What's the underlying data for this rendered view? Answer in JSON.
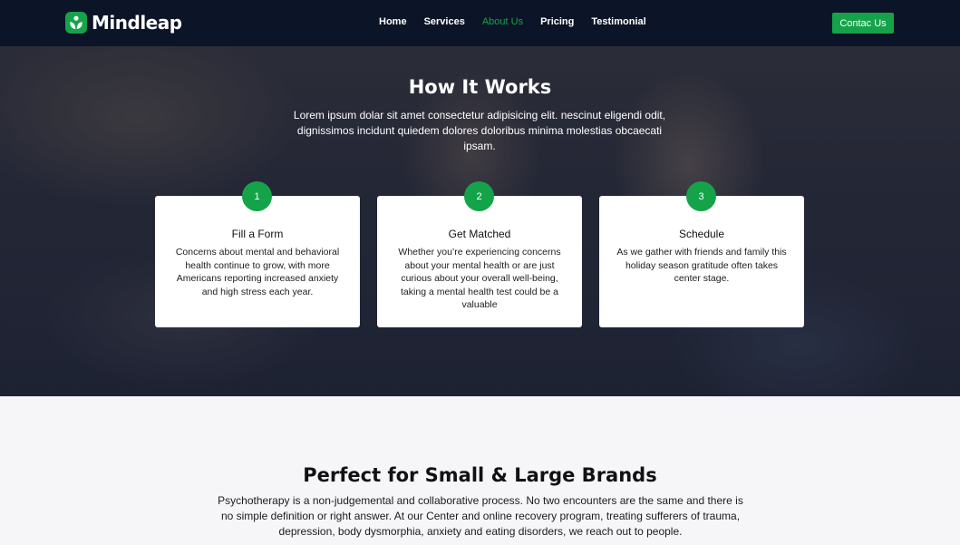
{
  "brand": {
    "name": "Mindleap",
    "accent": "#15a34a",
    "nav_bg": "#0c1527"
  },
  "nav": {
    "items": [
      {
        "label": "Home",
        "active": false
      },
      {
        "label": "Services",
        "active": false
      },
      {
        "label": "About Us",
        "active": true
      },
      {
        "label": "Pricing",
        "active": false
      },
      {
        "label": "Testimonial",
        "active": false
      }
    ],
    "cta": "Contac Us"
  },
  "hero": {
    "title": "How It Works",
    "description": "Lorem ipsum dolar sit amet consectetur adipisicing elit. nescinut eligendi odit, dignissimos incidunt quiedem dolores doloribus minima molestias obcaecati ipsam.",
    "steps": [
      {
        "number": "1",
        "title": "Fill a Form",
        "text": "Concerns about mental and behavioral health continue to grow, with more Americans reporting increased anxiety and high stress each year."
      },
      {
        "number": "2",
        "title": "Get Matched",
        "text": "Whether you’re experiencing concerns about your mental health or are just curious about your overall well-being, taking a mental health test could be a valuable"
      },
      {
        "number": "3",
        "title": "Schedule",
        "text": "As we gather with friends and family this holiday season gratitude often takes center stage."
      }
    ]
  },
  "brands_section": {
    "title": "Perfect for Small & Large Brands",
    "text": "Psychotherapy is a non-judgemental and collaborative process. No two encounters are the same and there is no simple definition or right answer. At our Center and online recovery program, treating sufferers of trauma, depression, body dysmorphia, anxiety and eating disorders, we reach out to people."
  },
  "icons": {
    "logo": "leaf-logo-icon"
  }
}
